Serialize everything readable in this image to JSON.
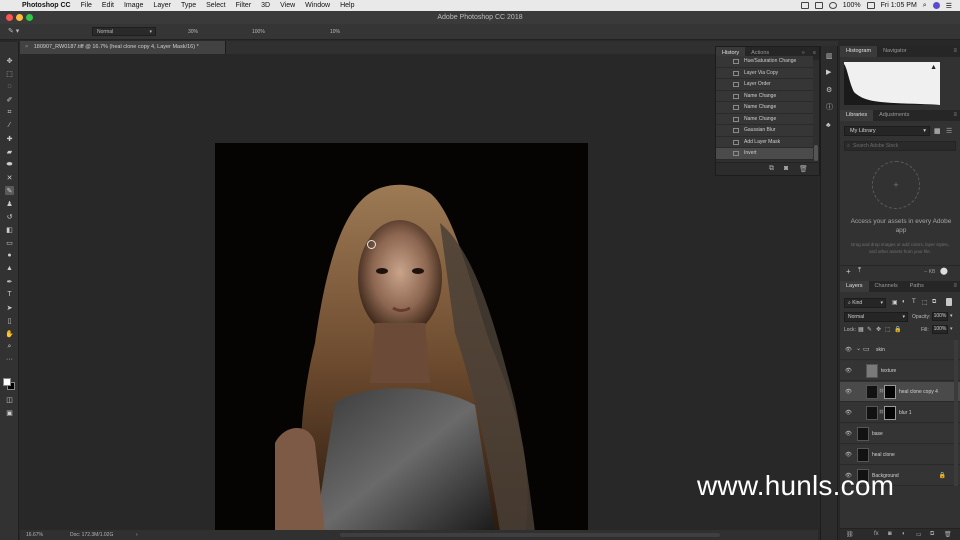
{
  "menubar": {
    "app_name": "Photoshop CC",
    "items": [
      "File",
      "Edit",
      "Image",
      "Layer",
      "Type",
      "Select",
      "Filter",
      "3D",
      "View",
      "Window",
      "Help"
    ],
    "battery": "100%",
    "clock": "Fri 1:05 PM"
  },
  "window": {
    "title": "Adobe Photoshop CC 2018"
  },
  "options_bar": {
    "mode": "Normal",
    "opacity": "30%",
    "flow": "100%",
    "smoothing": "10%"
  },
  "document": {
    "tab_title": "180907_RW0187.tiff @ 16.7% (heal clone copy 4, Layer Mask/16) *",
    "close_glyph": "×"
  },
  "status": {
    "zoom": "16.67%",
    "doc_size": "Doc: 172.3M/1.02G",
    "arrow": "›"
  },
  "history_panel": {
    "tabs": [
      "History",
      "Actions"
    ],
    "items": [
      {
        "label": "Hue/Saturation Change",
        "selected": false
      },
      {
        "label": "Layer Via Copy",
        "selected": false
      },
      {
        "label": "Layer Order",
        "selected": false
      },
      {
        "label": "Name Change",
        "selected": false
      },
      {
        "label": "Name Change",
        "selected": false
      },
      {
        "label": "Name Change",
        "selected": false
      },
      {
        "label": "Gaussian Blur",
        "selected": false
      },
      {
        "label": "Add Layer Mask",
        "selected": false
      },
      {
        "label": "Invert",
        "selected": true
      }
    ]
  },
  "histogram_panel": {
    "tabs": [
      "Histogram",
      "Navigator"
    ]
  },
  "libraries_panel": {
    "tabs": [
      "Libraries",
      "Adjustments"
    ],
    "library_select": "My Library",
    "search_placeholder": "Search Adobe Stock",
    "plus_glyph": "+",
    "headline": "Access your assets in every Adobe app",
    "subtext": "Drag and drop images or add colors, layer styles, and other assets from your file.",
    "footer_size": "-- KB"
  },
  "layers_panel": {
    "tabs": [
      "Layers",
      "Channels",
      "Paths"
    ],
    "filter_kind": "Kind",
    "blend_mode": "Normal",
    "opacity_label": "Opacity:",
    "opacity_value": "100%",
    "lock_label": "Lock:",
    "fill_label": "Fill:",
    "fill_value": "100%",
    "layers": [
      {
        "name": "skin",
        "type": "group",
        "selected": false
      },
      {
        "name": "texture",
        "type": "gray",
        "selected": false
      },
      {
        "name": "heal clone copy 4",
        "type": "masked",
        "selected": true
      },
      {
        "name": "blur 1",
        "type": "masked",
        "selected": false
      },
      {
        "name": "base",
        "type": "plain",
        "selected": false
      },
      {
        "name": "heal clone",
        "type": "plain",
        "selected": false
      },
      {
        "name": "Background",
        "type": "locked",
        "selected": false
      }
    ]
  },
  "watermark": "www.hunls.com",
  "colors": {
    "menubar_bg": "#e9e9e9",
    "panel_bg": "#323232",
    "canvas_bg": "#282828",
    "selected_row": "#4a4a4a",
    "close_red": "#fc5753",
    "min_yellow": "#fdbc40",
    "max_green": "#33c748"
  }
}
